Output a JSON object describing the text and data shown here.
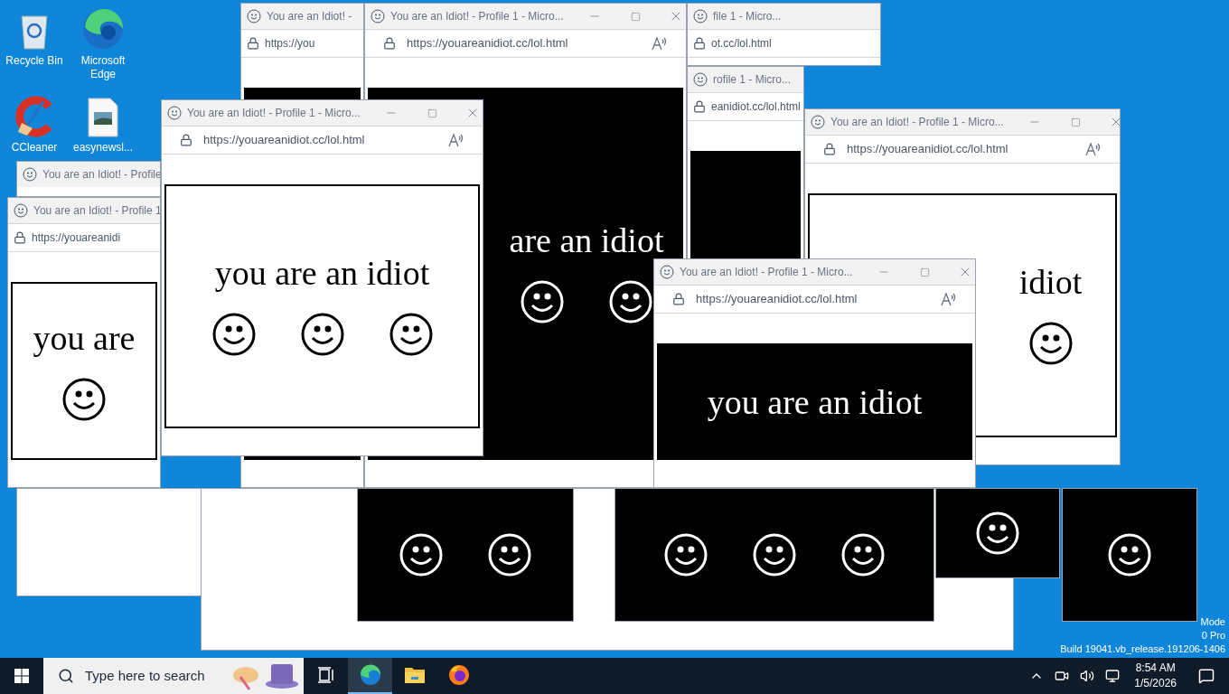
{
  "desktop_icons": [
    {
      "label": "Recycle Bin",
      "kind": "bin"
    },
    {
      "label": "Microsoft Edge",
      "kind": "edge"
    },
    {
      "label": "CCleaner",
      "kind": "ccleaner"
    },
    {
      "label": "easynewsl...",
      "kind": "file"
    }
  ],
  "desktop_text": [
    "Mode",
    "0 Pro",
    "Build 19041.vb_release.191206-1406"
  ],
  "windows": [
    {
      "kind": "browser",
      "title": "You are an Idiot! -",
      "url": "https://you",
      "dark": true
    },
    {
      "kind": "browser",
      "title": "You are an Idiot! - Profile 1 - Micro...",
      "url": "https://youareanidiot.cc/lol.html",
      "dark": true,
      "content": [
        {
          "kind": "text",
          "text": "are an idiot"
        },
        {
          "kind": "smiley"
        },
        {
          "kind": "smiley"
        }
      ]
    },
    {
      "kind": "browser",
      "title": "file 1 - Micro...",
      "url": "ot.cc/lol.html"
    },
    {
      "kind": "browser",
      "title": "rofile 1 - Micro...",
      "url": "eanidiot.cc/lol.html",
      "dark": true
    },
    {
      "kind": "browser",
      "title": "You are an Idiot! - Profile 1 - Micro...",
      "url": "https://youareanidiot.cc/lol.html",
      "dark": false,
      "content": [
        {
          "kind": "text",
          "text": "you are an idiot"
        },
        {
          "kind": "smiley"
        },
        {
          "kind": "smiley"
        },
        {
          "kind": "smiley"
        }
      ]
    },
    {
      "kind": "browser",
      "title": "You are an Idiot! - Profile 1 - Micro...",
      "url": "https://youareanidiot.cc/lol.html",
      "dark": false,
      "content": [
        {
          "kind": "text",
          "text": "idiot"
        },
        {
          "kind": "smiley"
        }
      ]
    },
    {
      "kind": "browser",
      "title": "You are an Idiot! - Profile"
    },
    {
      "kind": "browser",
      "title": "You are an Idiot! - Profile 1",
      "url": "https://youareanidi",
      "dark": false,
      "content": [
        {
          "kind": "text",
          "text": "you are"
        },
        {
          "kind": "smiley"
        }
      ]
    },
    {
      "kind": "browser",
      "title": "You are an Idiot! - Profile 1 - Micro...",
      "url": "https://youareanidiot.cc/lol.html",
      "dark": true,
      "content": [
        {
          "kind": "text",
          "text": "you are an idiot"
        }
      ]
    },
    {
      "kind": "page",
      "dark": false
    },
    {
      "kind": "page",
      "dark": false
    },
    {
      "kind": "page",
      "dark": true,
      "content": [
        {
          "kind": "smiley"
        },
        {
          "kind": "smiley"
        }
      ]
    },
    {
      "kind": "page",
      "dark": true,
      "content": [
        {
          "kind": "smiley"
        },
        {
          "kind": "smiley"
        },
        {
          "kind": "smiley"
        }
      ]
    },
    {
      "kind": "page",
      "dark": true,
      "content": [
        {
          "kind": "smiley"
        }
      ]
    },
    {
      "kind": "page",
      "dark": true,
      "content": [
        {
          "kind": "smiley"
        }
      ]
    }
  ],
  "taskbar": {
    "search": {
      "placeholder": "Type here to search"
    },
    "apps": [
      {
        "kind": "taskview",
        "selected": false
      },
      {
        "kind": "edge",
        "selected": true
      },
      {
        "kind": "explorer",
        "selected": false
      },
      {
        "kind": "firefox",
        "selected": false
      }
    ],
    "time": "8:54 AM",
    "date": "1/5/2026"
  }
}
